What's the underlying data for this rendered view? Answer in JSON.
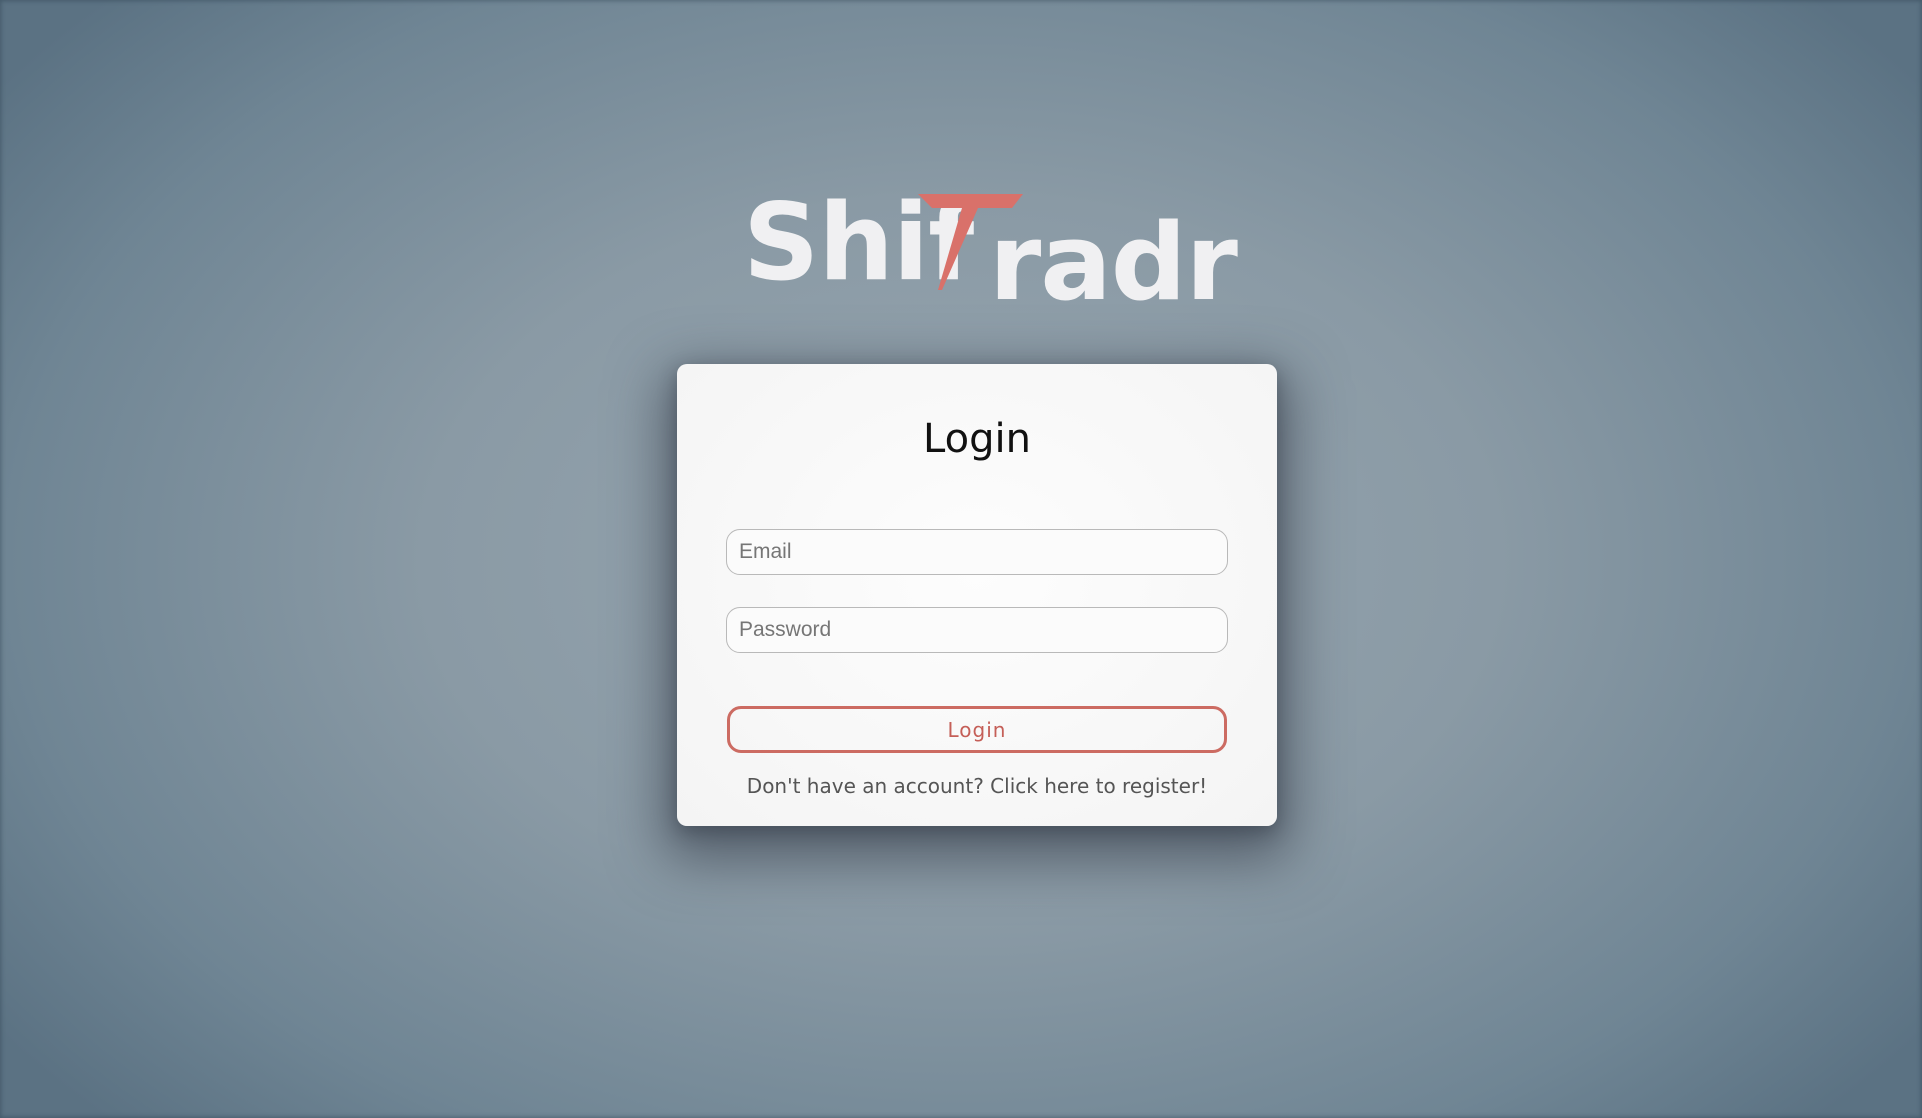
{
  "logo": {
    "left": "Shif",
    "accent": "T",
    "right": "radr",
    "text_color": "#f0f0f2",
    "accent_color": "#d9716a"
  },
  "login_card": {
    "title": "Login",
    "email_placeholder": "Email",
    "password_placeholder": "Password",
    "login_button_label": "Login",
    "register_text": "Don't have an account? Click here to register!"
  },
  "colors": {
    "background": "#8a9aa5",
    "card": "#f7f7f7",
    "accent": "#cc6b62"
  }
}
